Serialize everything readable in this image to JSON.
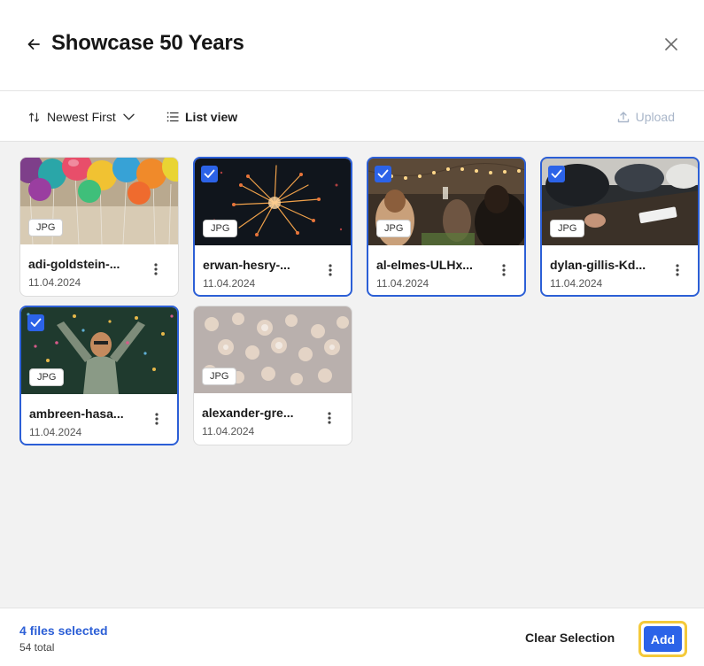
{
  "header": {
    "title": "Showcase 50 Years"
  },
  "toolbar": {
    "sort_label": "Newest First",
    "view_label": "List view",
    "upload_label": "Upload"
  },
  "files": [
    {
      "name": "adi-goldstein-...",
      "date": "11.04.2024",
      "type": "JPG",
      "selected": false,
      "thumb": "balloons"
    },
    {
      "name": "erwan-hesry-...",
      "date": "11.04.2024",
      "type": "JPG",
      "selected": true,
      "thumb": "fireworks"
    },
    {
      "name": "al-elmes-ULHx...",
      "date": "11.04.2024",
      "type": "JPG",
      "selected": true,
      "thumb": "party"
    },
    {
      "name": "dylan-gillis-Kd...",
      "date": "11.04.2024",
      "type": "JPG",
      "selected": true,
      "thumb": "meeting"
    },
    {
      "name": "ambreen-hasa...",
      "date": "11.04.2024",
      "type": "JPG",
      "selected": true,
      "thumb": "confetti"
    },
    {
      "name": "alexander-gre...",
      "date": "11.04.2024",
      "type": "JPG",
      "selected": false,
      "thumb": "bokeh"
    }
  ],
  "footer": {
    "selected_label": "4 files selected",
    "total_label": "54 total",
    "clear_label": "Clear Selection",
    "add_label": "Add"
  },
  "colors": {
    "accent": "#2c63e8",
    "focus_ring": "#f4c93a",
    "selected_border": "#2c5fd6"
  }
}
